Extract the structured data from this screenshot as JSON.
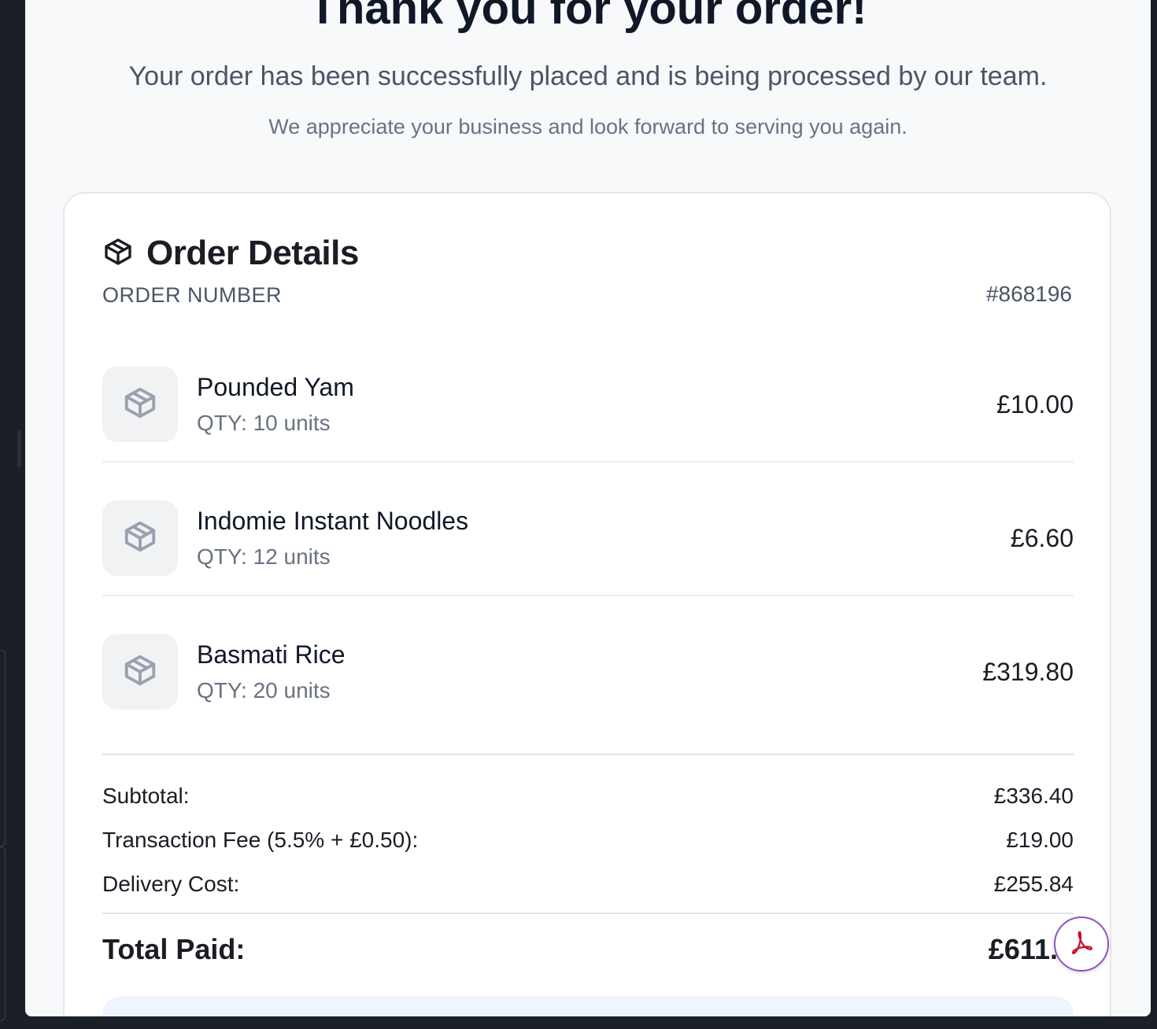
{
  "header": {
    "title": "Thank you for your order!",
    "subtitle": "Your order has been successfully placed and is being processed by our team.",
    "appreciation": "We appreciate your business and look forward to serving you again."
  },
  "order": {
    "title": "Order Details",
    "title_icon": "package-icon",
    "number_label": "ORDER NUMBER",
    "number_value": "#868196",
    "items": [
      {
        "name": "Pounded Yam",
        "qty": "QTY: 10 units",
        "price": "£10.00",
        "icon": "package-icon"
      },
      {
        "name": "Indomie Instant Noodles",
        "qty": "QTY: 12 units",
        "price": "£6.60",
        "icon": "package-icon"
      },
      {
        "name": "Basmati Rice",
        "qty": "QTY: 20 units",
        "price": "£319.80",
        "icon": "package-icon"
      }
    ],
    "summary": {
      "subtotal_label": "Subtotal:",
      "subtotal_value": "£336.40",
      "fee_label": "Transaction Fee (5.5% + £0.50):",
      "fee_value": "£19.00",
      "delivery_label": "Delivery Cost:",
      "delivery_value": "£255.84",
      "total_label": "Total Paid:",
      "total_value": "£611.2"
    }
  },
  "floating": {
    "icon": "acrobat-pdf-icon"
  },
  "colors": {
    "page_bg": "#f8f9fb",
    "card_bg": "#ffffff",
    "heading": "#101828",
    "muted": "#6a7282",
    "pdf_red": "#c8102e",
    "pdf_ring": "#8e52c8"
  }
}
